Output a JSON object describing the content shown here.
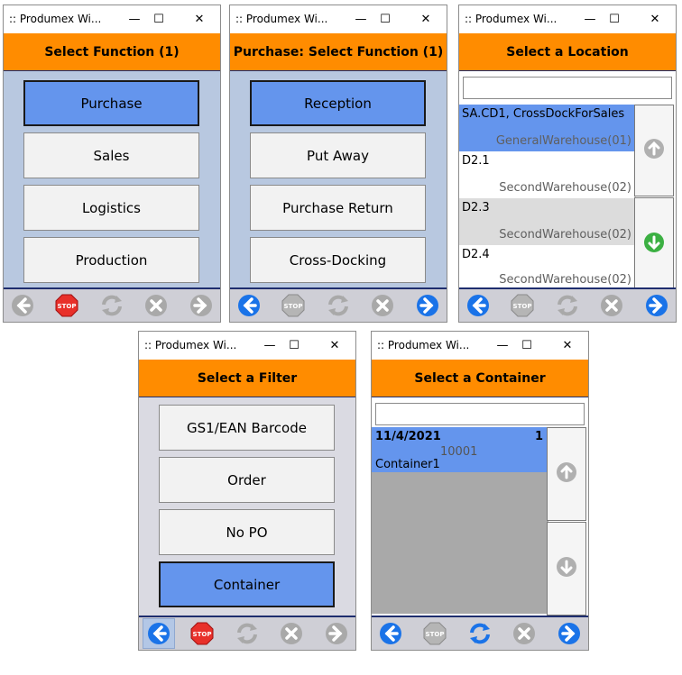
{
  "windows": [
    {
      "title": ":: Produmex Wi...",
      "header": "Select Function (1)",
      "buttons": [
        {
          "label": "Purchase",
          "selected": true
        },
        {
          "label": "Sales",
          "selected": false
        },
        {
          "label": "Logistics",
          "selected": false
        },
        {
          "label": "Production",
          "selected": false
        }
      ]
    },
    {
      "title": ":: Produmex Wi...",
      "header": "Purchase: Select Function (1)",
      "buttons": [
        {
          "label": "Reception",
          "selected": true
        },
        {
          "label": "Put Away",
          "selected": false
        },
        {
          "label": "Purchase Return",
          "selected": false
        },
        {
          "label": "Cross-Docking",
          "selected": false
        }
      ]
    },
    {
      "title": ":: Produmex Wi...",
      "header": "Select a Location",
      "search_value": "",
      "locations": [
        {
          "code": "SA.CD1, CrossDockForSales",
          "warehouse": "GeneralWarehouse(01)",
          "selected": true
        },
        {
          "code": "D2.1",
          "warehouse": "SecondWarehouse(02)",
          "selected": false
        },
        {
          "code": "D2.3",
          "warehouse": "SecondWarehouse(02)",
          "selected": false
        },
        {
          "code": "D2.4",
          "warehouse": "SecondWarehouse(02)",
          "selected": false
        }
      ]
    },
    {
      "title": ":: Produmex Wi...",
      "header": "Select a Filter",
      "buttons": [
        {
          "label": "GS1/EAN Barcode",
          "selected": false
        },
        {
          "label": "Order",
          "selected": false
        },
        {
          "label": "No PO",
          "selected": false
        },
        {
          "label": "Container",
          "selected": true
        }
      ]
    },
    {
      "title": ":: Produmex Wi...",
      "header": "Select a Container",
      "search_value": "",
      "container": {
        "date": "11/4/2021",
        "count": "1",
        "number": "10001",
        "name": "Container1"
      }
    }
  ],
  "window_controls": {
    "minimize": "—",
    "maximize": "☐",
    "close": "✕"
  },
  "icons": [
    "back-arrow-icon",
    "stop-icon",
    "refresh-icon",
    "cancel-icon",
    "forward-arrow-icon",
    "scroll-up-icon",
    "scroll-down-icon"
  ],
  "colors": {
    "header": "#ff8c00",
    "selected": "#6495ed",
    "nav_blue": "#1a73e8",
    "stop_red": "#e8302a"
  }
}
